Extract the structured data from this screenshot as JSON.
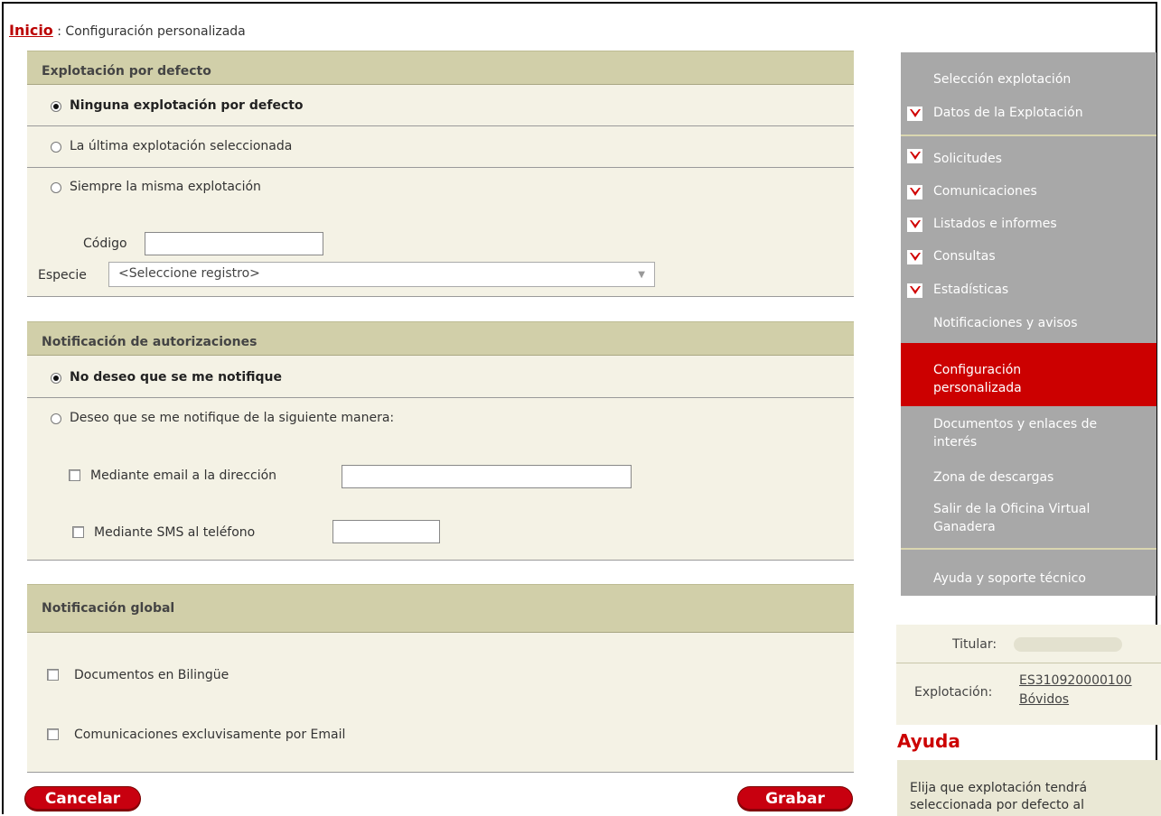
{
  "breadcrumb": {
    "home": "Inicio",
    "separator": " : ",
    "current": "Configuración personalizada"
  },
  "section_default": {
    "title": "Explotación por defecto",
    "options": [
      {
        "label": "Ninguna explotación por defecto",
        "selected": true
      },
      {
        "label": "La última explotación seleccionada",
        "selected": false
      },
      {
        "label": "Siempre la misma explotación",
        "selected": false
      }
    ],
    "codigo_label": "Código",
    "codigo_value": "",
    "especie_label": "Especie",
    "especie_value": "<Seleccione registro>"
  },
  "section_auth": {
    "title": "Notificación de autorizaciones",
    "options": [
      {
        "label": "No deseo que se me notifique",
        "selected": true
      },
      {
        "label": "Deseo que se me notifique de la siguiente manera:",
        "selected": false
      }
    ],
    "email_label": "Mediante email a la dirección",
    "email_value": "",
    "sms_label": "Mediante SMS al teléfono",
    "sms_value": ""
  },
  "section_global": {
    "title": "Notificación global",
    "checks": [
      {
        "label": "Documentos en Bilingüe",
        "checked": false
      },
      {
        "label": "Comunicaciones excluvisamente por Email",
        "checked": false
      }
    ]
  },
  "buttons": {
    "cancel": "Cancelar",
    "save": "Grabar"
  },
  "menu": {
    "items": [
      {
        "label": "Selección explotación",
        "icon": "chevron-down-icon",
        "has_icon": false
      },
      {
        "label": "Datos de la Explotación",
        "icon": "chevron-down-icon",
        "has_icon": true
      },
      {
        "label": "Solicitudes",
        "icon": "chevron-down-icon",
        "has_icon": true
      },
      {
        "label": "Comunicaciones",
        "icon": "chevron-down-icon",
        "has_icon": true
      },
      {
        "label": "Listados e informes",
        "icon": "chevron-down-icon",
        "has_icon": true
      },
      {
        "label": "Consultas",
        "icon": "chevron-down-icon",
        "has_icon": true
      },
      {
        "label": "Estadísticas",
        "icon": "chevron-down-icon",
        "has_icon": true
      },
      {
        "label": "Notificaciones y avisos",
        "has_icon": false
      },
      {
        "label_line1": "Configuración",
        "label_line2": "personalizada",
        "active": true
      },
      {
        "label_line1": "Documentos y enlaces de",
        "label_line2": "interés"
      },
      {
        "label": "Zona de descargas"
      },
      {
        "label_line1": "Salir de la Oficina Virtual",
        "label_line2": "Ganadera"
      },
      {
        "label": "Ayuda y soporte técnico"
      }
    ],
    "active_color": "#cc0000",
    "bg_color": "#a8a8a8"
  },
  "info": {
    "titular_label": "Titular:",
    "explotacion_label": "Explotación:",
    "explotacion_code": "ES310920000100",
    "explotacion_species": "Bóvidos"
  },
  "help": {
    "title": "Ayuda",
    "line1": "Elija que explotación tendrá",
    "line2": "seleccionada por defecto al"
  }
}
